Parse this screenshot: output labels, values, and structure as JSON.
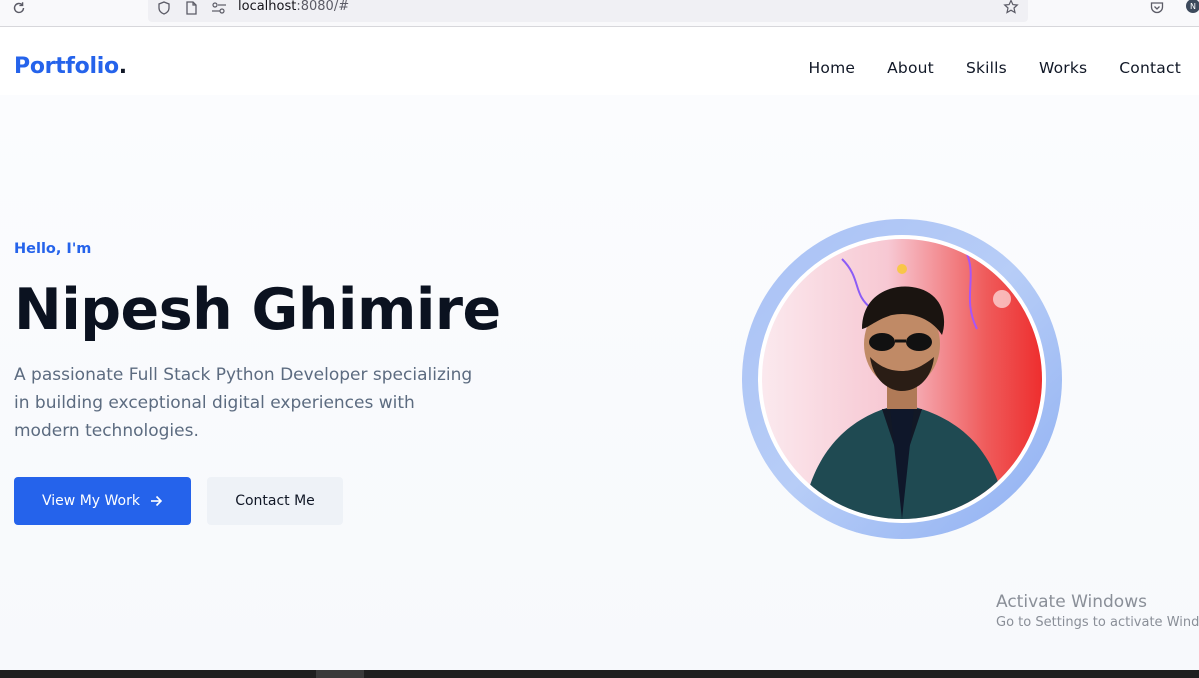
{
  "browser": {
    "url_host": "localhost",
    "url_rest": ":8080/#"
  },
  "site": {
    "logo_text": "Portfolio",
    "logo_dot": ".",
    "nav": [
      {
        "label": "Home"
      },
      {
        "label": "About"
      },
      {
        "label": "Skills"
      },
      {
        "label": "Works"
      },
      {
        "label": "Contact"
      }
    ]
  },
  "hero": {
    "greeting": "Hello, I'm",
    "name": "Nipesh Ghimire",
    "tagline": "A passionate Full Stack Python Developer specializing in building exceptional digital experiences with modern technologies.",
    "primary_button": "View My Work",
    "secondary_button": "Contact Me"
  },
  "watermark": {
    "title": "Activate Windows",
    "subtitle": "Go to Settings to activate Windows."
  },
  "colors": {
    "accent": "#2563eb",
    "heading": "#0b1220",
    "body_text": "#5c6b80"
  }
}
